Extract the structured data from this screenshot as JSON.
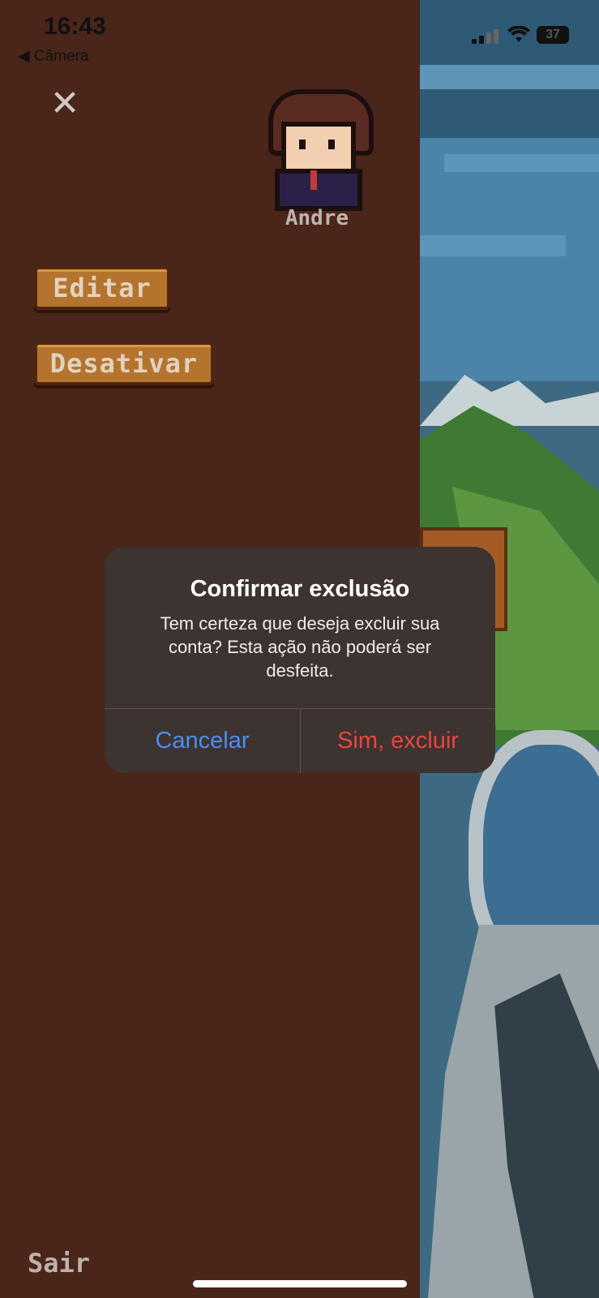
{
  "status_bar": {
    "time": "16:43",
    "back_app": "◀ Câmera",
    "battery": "37"
  },
  "profile": {
    "username": "Andre"
  },
  "menu": {
    "edit_label": "Editar",
    "deactivate_label": "Desativar",
    "logout_label": "Sair"
  },
  "alert": {
    "title": "Confirmar exclusão",
    "message": "Tem certeza que deseja excluir sua conta? Esta ação não poderá ser desfeita.",
    "cancel_label": "Cancelar",
    "confirm_label": "Sim, excluir"
  },
  "colors": {
    "panel_bg": "#4a2519",
    "button_bg": "#b5742e",
    "cancel": "#4a8ef0",
    "destructive": "#e8453f"
  },
  "icons": {
    "close": "close-icon",
    "wifi": "wifi-icon",
    "signal": "signal-icon",
    "battery": "battery-icon"
  }
}
